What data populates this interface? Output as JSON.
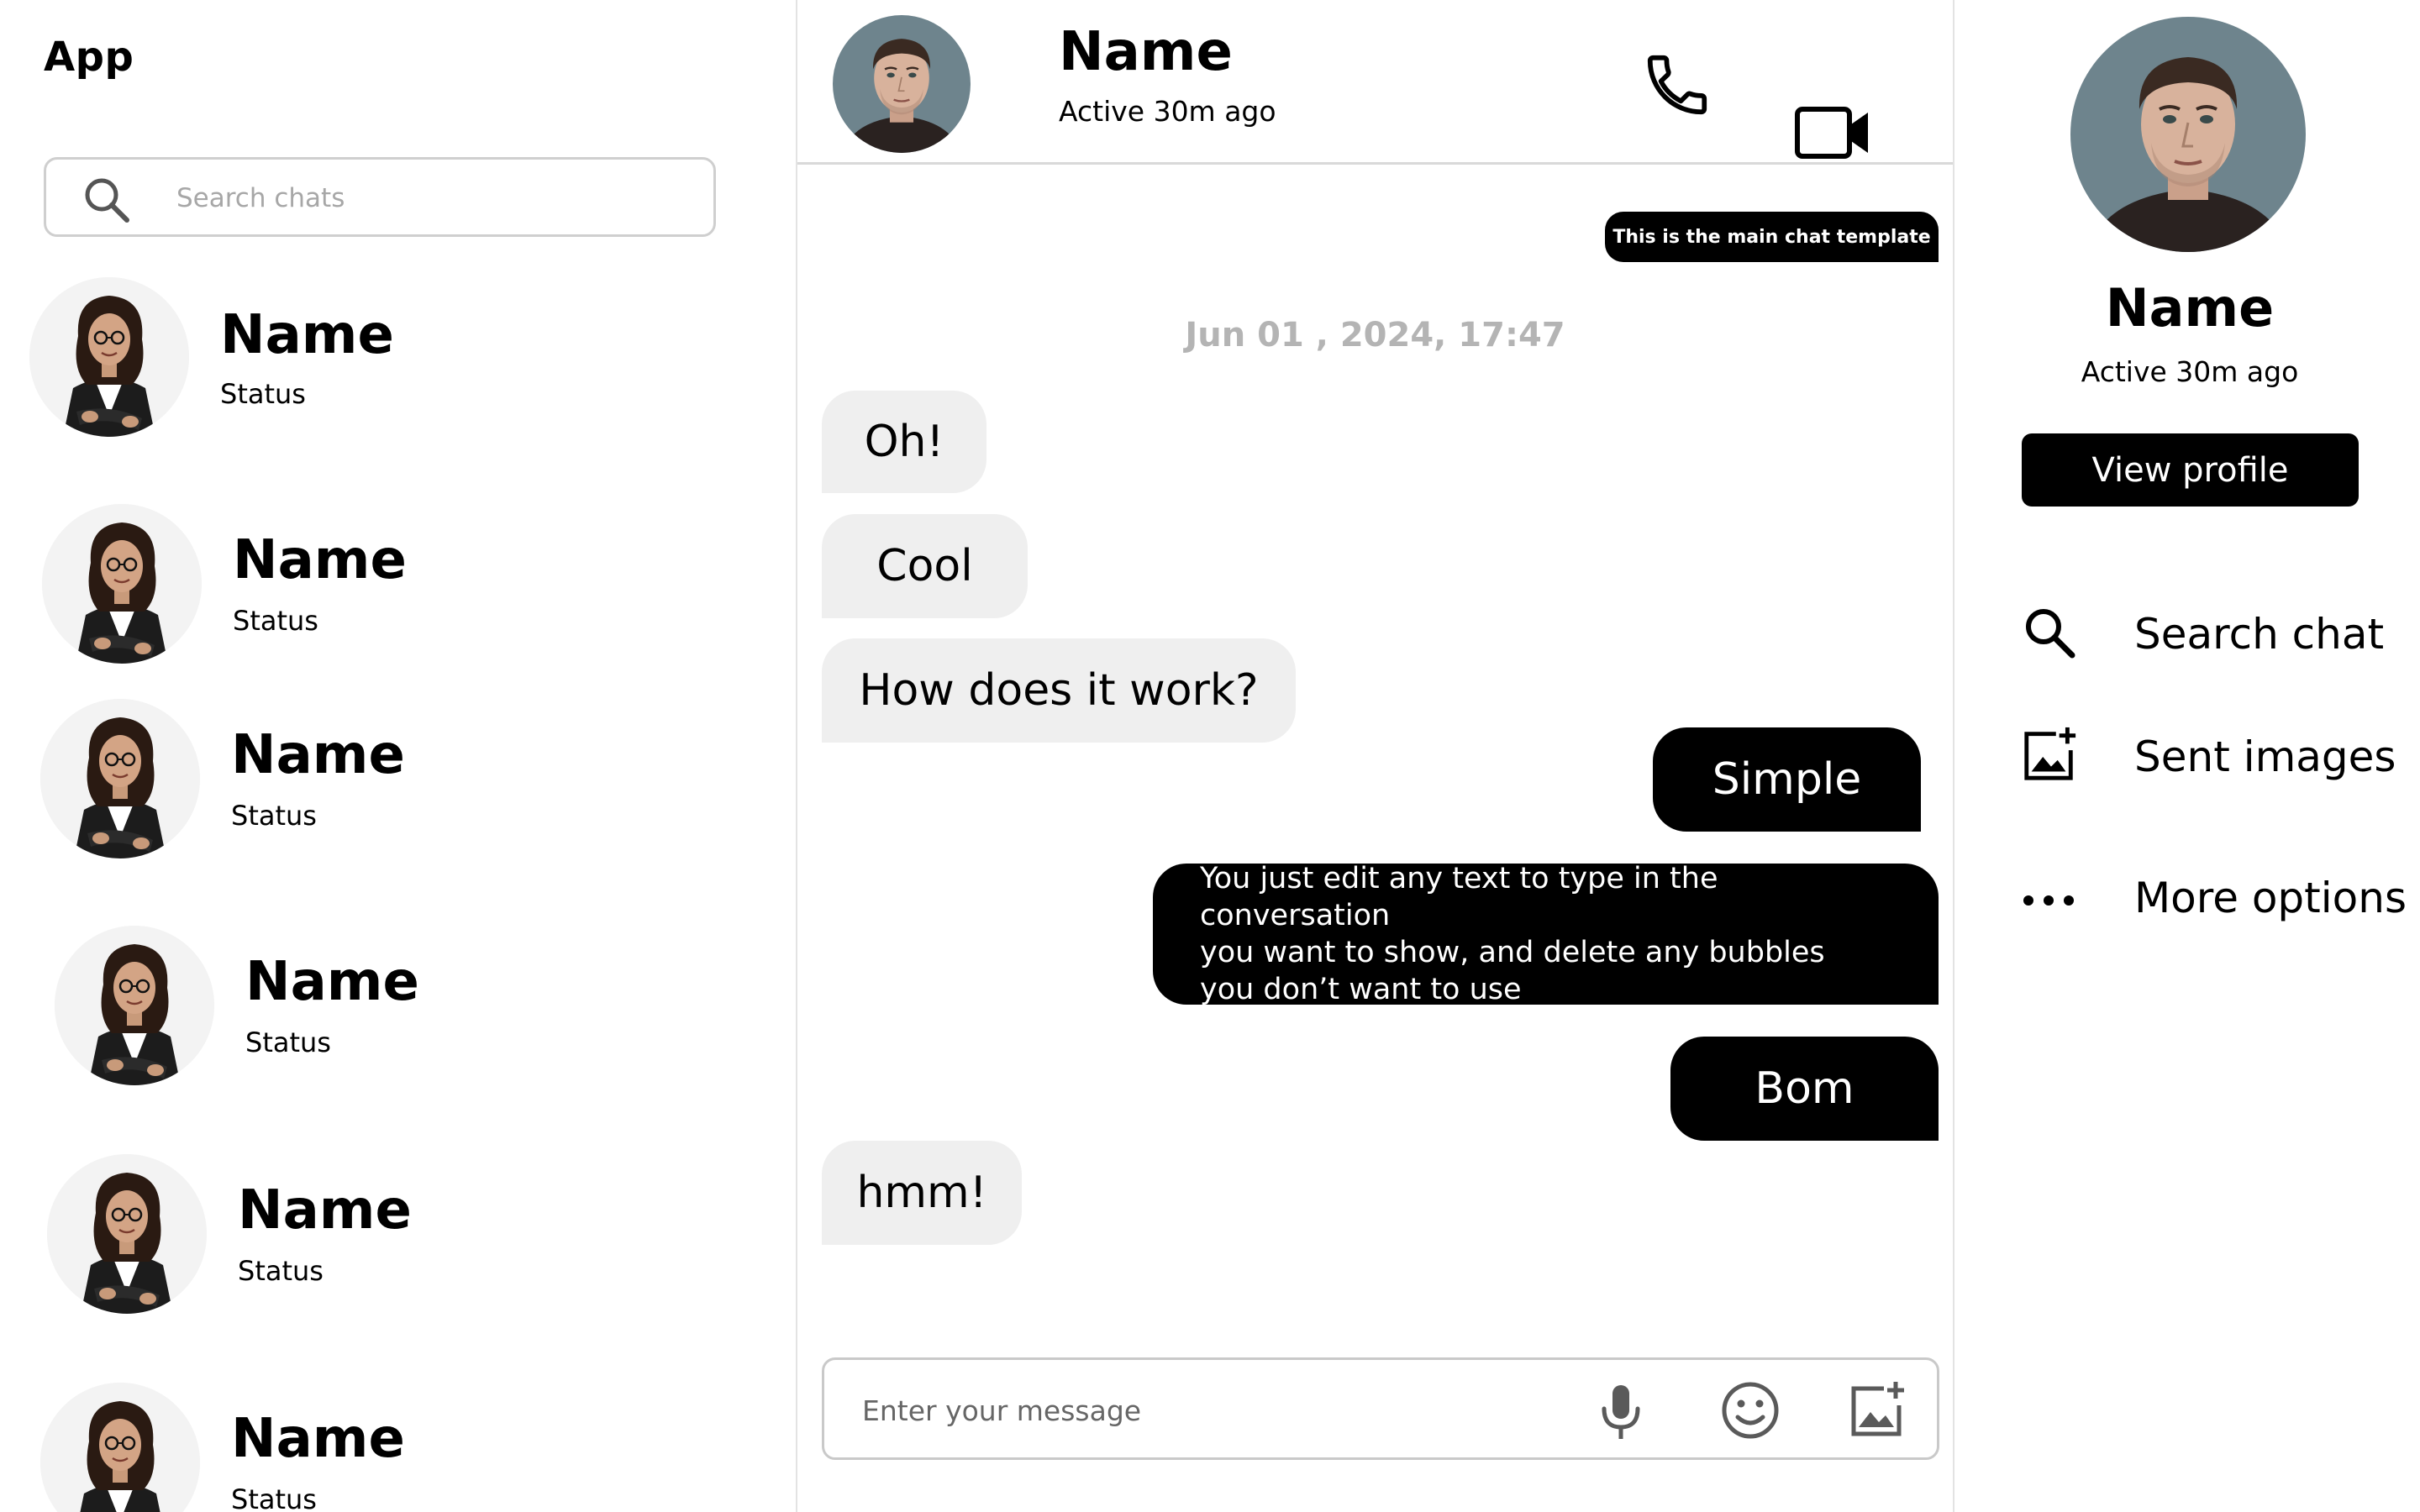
{
  "app": {
    "title": "App"
  },
  "sidebar": {
    "search_placeholder": "Search chats",
    "contacts": [
      {
        "name": "Name",
        "status": "Status"
      },
      {
        "name": "Name",
        "status": "Status"
      },
      {
        "name": "Name",
        "status": "Status"
      },
      {
        "name": "Name",
        "status": "Status"
      },
      {
        "name": "Name",
        "status": "Status"
      },
      {
        "name": "Name",
        "status": "Status"
      }
    ]
  },
  "chat": {
    "header": {
      "name": "Name",
      "status": "Active 30m ago"
    },
    "note": "This is the main chat template",
    "date": "Jun 01 , 2024, 17:47",
    "messages": [
      {
        "direction": "in",
        "text": "Oh!"
      },
      {
        "direction": "in",
        "text": "Cool"
      },
      {
        "direction": "in",
        "text": "How does it work?"
      },
      {
        "direction": "out",
        "text": "Simple"
      },
      {
        "direction": "out",
        "text": "You just edit any text to type in the conversation\n you want to show, and delete any bubbles\nyou don’t  want to use"
      },
      {
        "direction": "out",
        "text": "Bom"
      },
      {
        "direction": "in",
        "text": "hmm!"
      }
    ],
    "composer_placeholder": "Enter your message"
  },
  "profile": {
    "name": "Name",
    "status": "Active 30m ago",
    "view_profile_label": "View profile",
    "actions": [
      {
        "icon": "search-icon",
        "label": "Search chat"
      },
      {
        "icon": "image-add-icon",
        "label": "Sent images"
      },
      {
        "icon": "more-horizontal-icon",
        "label": "More options"
      }
    ]
  },
  "colors": {
    "accent": "#000000",
    "incoming_bubble": "#efefef",
    "date_text": "#b4b4b4",
    "border": "#d9d9d9"
  }
}
